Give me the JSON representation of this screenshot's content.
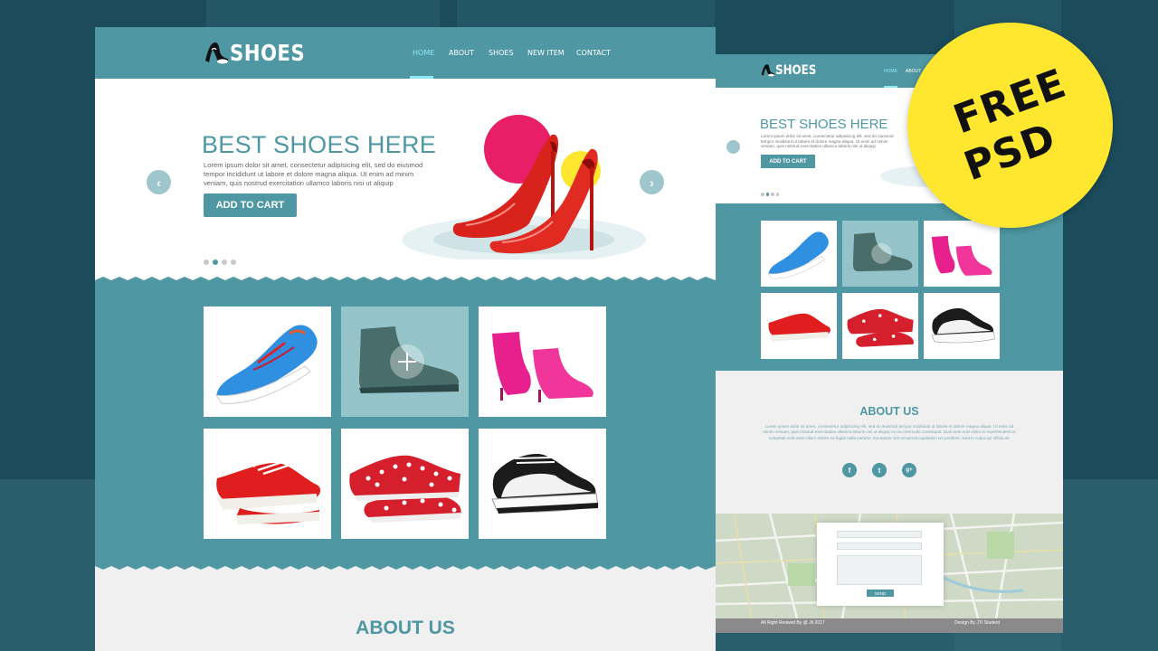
{
  "brand": {
    "name": "SHOES"
  },
  "nav": {
    "items": [
      "HOME",
      "ABOUT",
      "SHOES",
      "NEW ITEM",
      "CONTACT"
    ]
  },
  "hero": {
    "title": "BEST SHOES HERE",
    "text": "Lorem ipsum dolor sit amet, consectetur adipisicing elit, sed do eiusmod tempor incididunt ut labore et dolore magna aliqua. Ut enim ad minim veniam, quis nostrud exercitation ullamco laboris nisi ut aliquip",
    "button": "ADD TO CART",
    "slides": 4,
    "active_slide": 1
  },
  "gallery": {
    "items": [
      "blue-running-shoe-icon",
      "grey-leather-boot-icon",
      "pink-ankle-boot-icon",
      "red-sneaker-icon",
      "red-polka-dot-shoe-icon",
      "black-white-skate-shoe-icon"
    ]
  },
  "about": {
    "title": "ABOUT US",
    "text": "Lorem ipsum dolor sit amet, consectetur adipisicing elit, sed do eiusmod tempor incididunt ut labore et dolore magna aliqua. Ut enim ad minim veniam, quis nostrud exercitation ullamco laboris nisi ut aliquip ex ea commodo consequat. Duis aute irure dolor in reprehenderit in voluptate velit esse cillum dolore eu fugiat nulla pariatur. Excepteur sint occaecat cupidatat non proident, sunt in culpa qui officia de"
  },
  "social": {
    "facebook": "f",
    "twitter": "t",
    "google": "g+"
  },
  "contact_form": {
    "send_label": "SEND"
  },
  "footer": {
    "left": "All Right Resived By @ Jti 2017",
    "right": "Design By JTI Student"
  },
  "badge": {
    "line1": "FREE",
    "line2": "PSD"
  },
  "colors": {
    "teal": "#4e97a3",
    "light_teal": "#94c3c9",
    "badge_yellow": "#ffe62f",
    "accent_cyan": "#8fe6f7"
  }
}
